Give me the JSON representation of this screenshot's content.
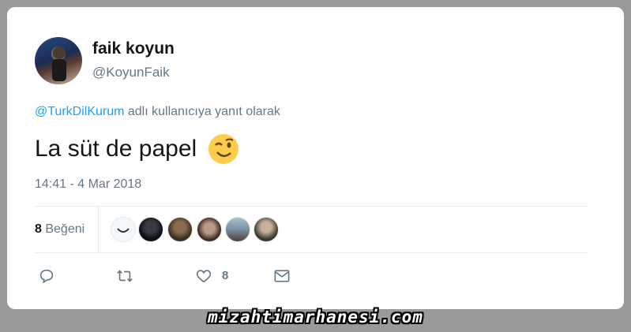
{
  "author": {
    "display_name": "faik koyun",
    "handle": "@KoyunFaik",
    "avatar": "profile-photo"
  },
  "reply_context": {
    "mention": "@TurkDilKurum",
    "suffix": " adlı kullanıcıya yanıt olarak"
  },
  "tweet": {
    "text": "La süt de papel",
    "emoji": "winking-face-emoji",
    "timestamp": "14:41 - 4 Mar 2018"
  },
  "likes": {
    "count": "8",
    "label": " Beğeni",
    "likers": [
      "liker-1",
      "liker-2",
      "liker-3",
      "liker-4",
      "liker-5",
      "liker-6"
    ]
  },
  "actions": {
    "reply_icon": "reply-icon",
    "retweet_icon": "retweet-icon",
    "like_icon": "heart-icon",
    "like_count": "8",
    "message_icon": "envelope-icon"
  },
  "watermark": "mizahtimarhanesi.com",
  "colors": {
    "link": "#1da1f2",
    "secondary_text": "#657786",
    "primary_text": "#14171a"
  }
}
